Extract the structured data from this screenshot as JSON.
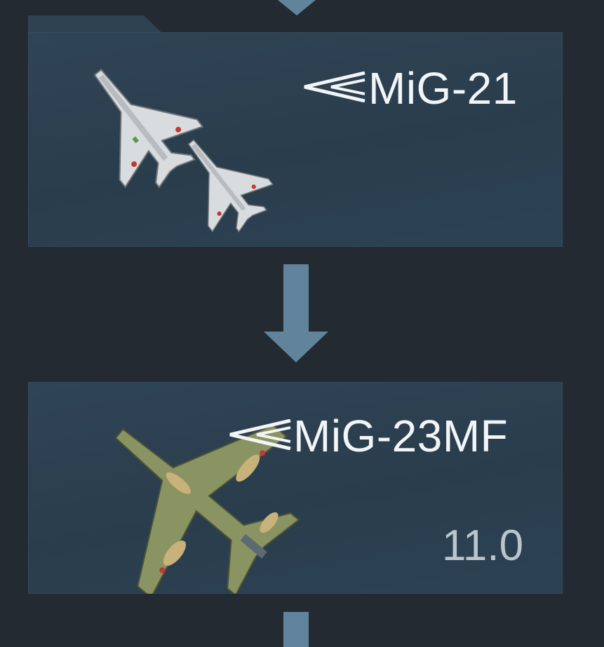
{
  "tree": {
    "vehicles": [
      {
        "name": "MiG-21",
        "nation_icon": "soviet-fighter-icon",
        "type_icon": "fighter-chevron-icon"
      },
      {
        "name": "MiG-23MF",
        "nation_icon": "soviet-fighter-icon",
        "type_icon": "fighter-chevron-icon",
        "battle_rating": "11.0"
      }
    ]
  },
  "colors": {
    "background": "#232a32",
    "card": "#2d4152",
    "arrow": "#61849c",
    "text": "#f2f5f7",
    "battle_rating": "#b9c6ce"
  }
}
